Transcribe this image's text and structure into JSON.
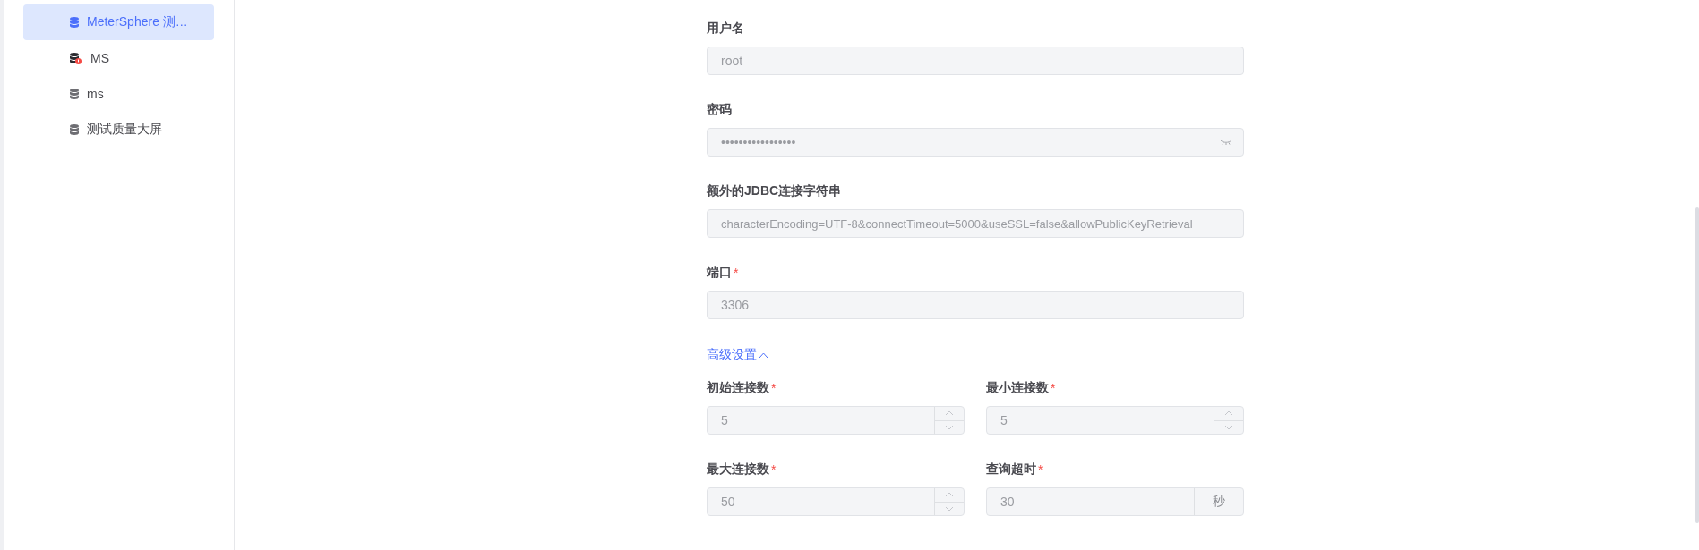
{
  "sidebar": {
    "items": [
      {
        "label": "MeterSphere 测…",
        "selected": true,
        "has_error": false
      },
      {
        "label": "MS",
        "selected": false,
        "has_error": true
      },
      {
        "label": "ms",
        "selected": false,
        "has_error": false
      },
      {
        "label": "测试质量大屏",
        "selected": false,
        "has_error": false
      }
    ]
  },
  "form": {
    "fields": [
      {
        "kind": "text",
        "label": "用户名",
        "value": "root"
      },
      {
        "kind": "password",
        "label": "密码",
        "value": "•••••••••••••••••"
      },
      {
        "kind": "text",
        "label": "额外的JDBC连接字符串",
        "value": "characterEncoding=UTF-8&connectTimeout=5000&useSSL=false&allowPublicKeyRetrieval"
      },
      {
        "kind": "text",
        "label": "端口",
        "required_mark": "*",
        "value": "3306"
      }
    ],
    "advanced": {
      "label": "高级设置",
      "expanded": true,
      "fields": [
        {
          "kind": "number",
          "label": "初始连接数",
          "required_mark": "*",
          "value": "5"
        },
        {
          "kind": "number",
          "label": "最小连接数",
          "required_mark": "*",
          "value": "5"
        },
        {
          "kind": "number",
          "label": "最大连接数",
          "required_mark": "*",
          "value": "50"
        },
        {
          "kind": "suffix",
          "label": "查询超时",
          "required_mark": "*",
          "value": "30",
          "suffix": "秒"
        }
      ]
    }
  }
}
